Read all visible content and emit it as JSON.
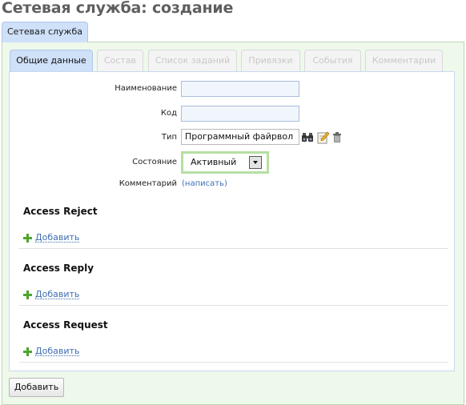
{
  "page": {
    "title": "Сетевая служба: создание"
  },
  "outer_tab": {
    "label": "Сетевая служба"
  },
  "tabs": [
    {
      "label": "Общие данные",
      "active": true
    },
    {
      "label": "Состав",
      "active": false
    },
    {
      "label": "Список заданий",
      "active": false
    },
    {
      "label": "Привязки",
      "active": false
    },
    {
      "label": "События",
      "active": false
    },
    {
      "label": "Комментарии",
      "active": false
    }
  ],
  "form": {
    "name_label": "Наименование",
    "name_value": "",
    "code_label": "Код",
    "code_value": "",
    "type_label": "Тип",
    "type_value": "Программный файрвол",
    "state_label": "Состояние",
    "state_value": "Активный",
    "comment_label": "Комментарий",
    "comment_link": "(написать)"
  },
  "sections": [
    {
      "title": "Access Reject",
      "add_label": "Добавить"
    },
    {
      "title": "Access Reply",
      "add_label": "Добавить"
    },
    {
      "title": "Access Request",
      "add_label": "Добавить"
    }
  ],
  "footer": {
    "submit_label": "Добавить"
  },
  "colors": {
    "tab_active": "#cfe0f9",
    "panel_bg": "#eef9ec",
    "link": "#3d6eb5",
    "add_icon": "#4da52c",
    "select_highlight": "#b6dfa2"
  },
  "icons": [
    "binoculars-icon",
    "edit-icon",
    "trash-icon",
    "plus-icon",
    "chevron-down-icon"
  ]
}
